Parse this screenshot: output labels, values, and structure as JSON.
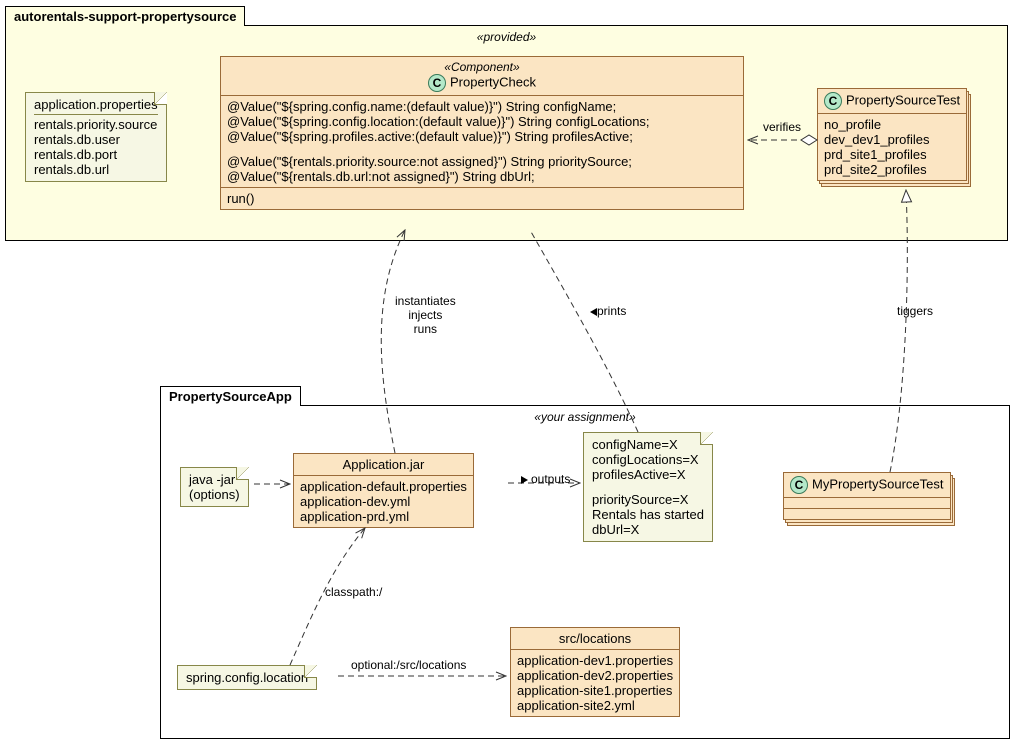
{
  "pkg_provided": {
    "name": "autorentals-support-propertysource",
    "stereotype": "«provided»"
  },
  "pkg_assignment": {
    "name": "PropertySourceApp",
    "stereotype": "«your assignment»"
  },
  "app_props": {
    "title": "application.properties",
    "l1": "rentals.priority.source",
    "l2": "rentals.db.user",
    "l3": "rentals.db.port",
    "l4": "rentals.db.url"
  },
  "property_check": {
    "stereotype": "«Component»",
    "name": "PropertyCheck",
    "a1": "@Value(\"${spring.config.name:(default value)}\") String configName;",
    "a2": "@Value(\"${spring.config.location:(default value)}\") String configLocations;",
    "a3": "@Value(\"${spring.profiles.active:(default value)}\") String profilesActive;",
    "a4": "@Value(\"${rentals.priority.source:not assigned}\") String prioritySource;",
    "a5": "@Value(\"${rentals.db.url:not assigned}\") String dbUrl;",
    "op1": "run()"
  },
  "property_source_test": {
    "name": "PropertySourceTest",
    "l1": "no_profile",
    "l2": "dev_dev1_profiles",
    "l3": "prd_site1_profiles",
    "l4": "prd_site2_profiles"
  },
  "java_jar": {
    "l1": "java -jar",
    "l2": "(options)"
  },
  "application_jar": {
    "title": "Application.jar",
    "l1": "application-default.properties",
    "l2": "application-dev.yml",
    "l3": "application-prd.yml"
  },
  "output_note": {
    "l1": "configName=X",
    "l2": "configLocations=X",
    "l3": "profilesActive=X",
    "l4": "prioritySource=X",
    "l5": "Rentals has started",
    "l6": "dbUrl=X"
  },
  "my_test": {
    "name": "MyPropertySourceTest"
  },
  "spring_config": {
    "text": "spring.config.location"
  },
  "src_locations": {
    "title": "src/locations",
    "l1": "application-dev1.properties",
    "l2": "application-dev2.properties",
    "l3": "application-site1.properties",
    "l4": "application-site2.yml"
  },
  "labels": {
    "verifies": "verifies",
    "instantiates": "instantiates\ninjects\nruns",
    "prints": "prints",
    "tiggers": "tiggers",
    "outputs": "outputs",
    "classpath": "classpath:/",
    "optional": "optional:/src/locations"
  }
}
